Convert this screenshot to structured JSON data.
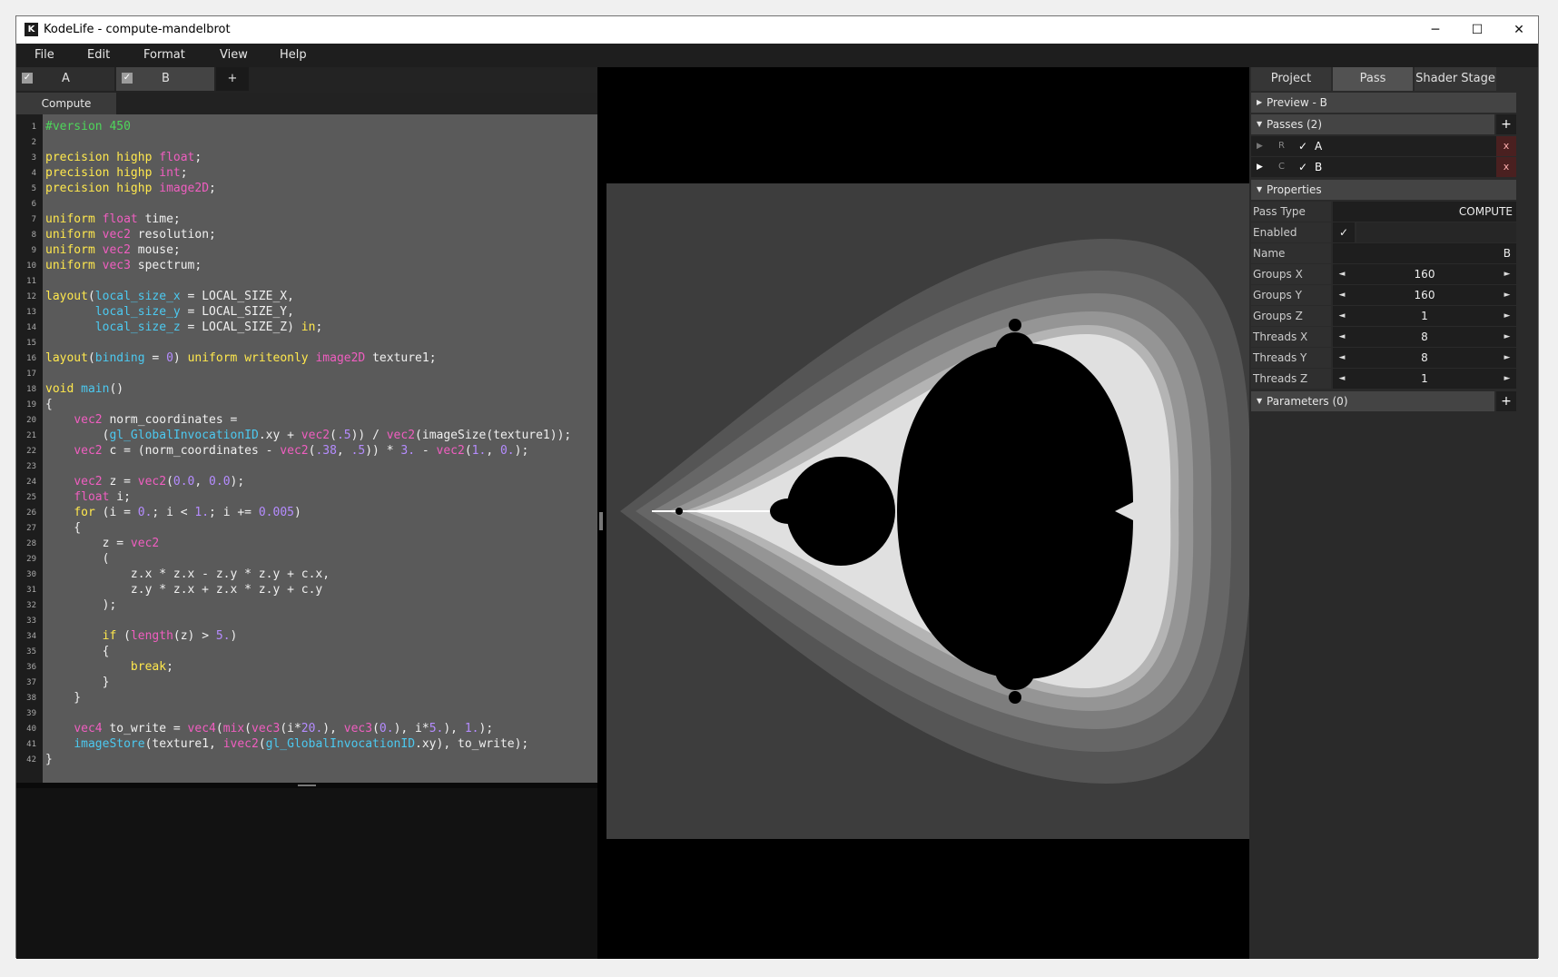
{
  "window": {
    "title": "KodeLife - compute-mandelbrot",
    "logo": "K"
  },
  "controls": {
    "minimize": "─",
    "maximize": "☐",
    "close": "✕"
  },
  "menu": [
    "File",
    "Edit",
    "Format",
    "View",
    "Help"
  ],
  "pass_tabs": [
    {
      "label": "A",
      "checked": true
    },
    {
      "label": "B",
      "checked": true
    }
  ],
  "add_tab": "+",
  "stage_tab": "Compute",
  "code_lines": [
    "#version 450",
    "",
    "precision highp float;",
    "precision highp int;",
    "precision highp image2D;",
    "",
    "uniform float time;",
    "uniform vec2 resolution;",
    "uniform vec2 mouse;",
    "uniform vec3 spectrum;",
    "",
    "layout(local_size_x = LOCAL_SIZE_X,",
    "       local_size_y = LOCAL_SIZE_Y,",
    "       local_size_z = LOCAL_SIZE_Z) in;",
    "",
    "layout(binding = 0) uniform writeonly image2D texture1;",
    "",
    "void main()",
    "{",
    "    vec2 norm_coordinates =",
    "        (gl_GlobalInvocationID.xy + vec2(.5)) / vec2(imageSize(texture1));",
    "    vec2 c = (norm_coordinates - vec2(.38, .5)) * 3. - vec2(1., 0.);",
    "",
    "    vec2 z = vec2(0.0, 0.0);",
    "    float i;",
    "    for (i = 0.; i < 1.; i += 0.005)",
    "    {",
    "        z = vec2",
    "        (",
    "            z.x * z.x - z.y * z.y + c.x,",
    "            z.y * z.x + z.x * z.y + c.y",
    "        );",
    "",
    "        if (length(z) > 5.)",
    "        {",
    "            break;",
    "        }",
    "    }",
    "",
    "    vec4 to_write = vec4(mix(vec3(i*20.), vec3(0.), i*5.), 1.);",
    "    imageStore(texture1, ivec2(gl_GlobalInvocationID.xy), to_write);",
    "}"
  ],
  "panel": {
    "tabs": [
      "Project",
      "Pass",
      "Shader Stage"
    ],
    "active_tab": "Pass",
    "preview_section": "Preview - B",
    "passes_section": "Passes (2)",
    "passes": [
      {
        "play": "▶",
        "type": "R",
        "check": "✓",
        "name": "A",
        "delete": "x"
      },
      {
        "play": "▶",
        "type": "C",
        "check": "✓",
        "name": "B",
        "delete": "x"
      }
    ],
    "properties_section": "Properties",
    "pass_type_label": "Pass Type",
    "pass_type_value": "COMPUTE",
    "enabled_label": "Enabled",
    "enabled_value": "✓",
    "name_label": "Name",
    "name_value": "B",
    "steppers": [
      {
        "label": "Groups X",
        "value": "160"
      },
      {
        "label": "Groups Y",
        "value": "160"
      },
      {
        "label": "Groups Z",
        "value": "1"
      },
      {
        "label": "Threads X",
        "value": "8"
      },
      {
        "label": "Threads Y",
        "value": "8"
      },
      {
        "label": "Threads Z",
        "value": "1"
      }
    ],
    "parameters_section": "Parameters (0)",
    "add": "+",
    "dec": "◄",
    "inc": "►"
  }
}
